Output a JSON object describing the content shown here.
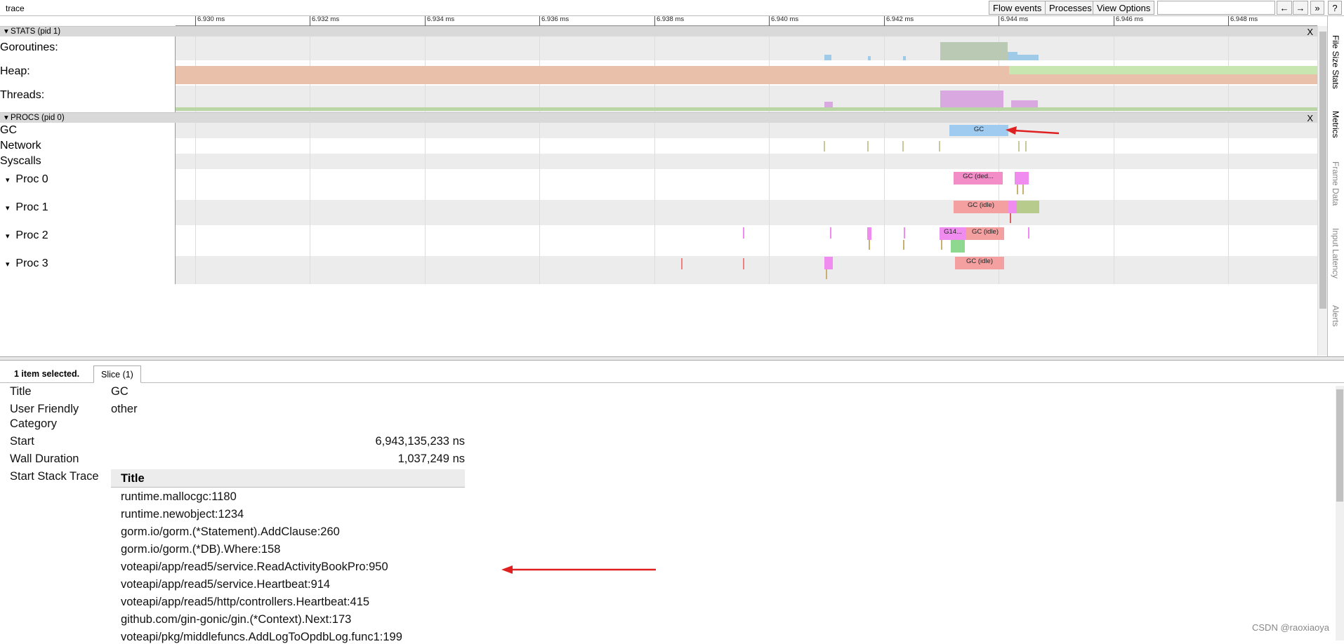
{
  "toolbar": {
    "title": "trace",
    "flow_events": "Flow events",
    "processes": "Processes",
    "view_options": "View Options",
    "search_value": "",
    "prev": "←",
    "next": "→",
    "more": "»",
    "help": "?"
  },
  "ruler": [
    "6.930 ms",
    "6.932 ms",
    "6.934 ms",
    "6.936 ms",
    "6.938 ms",
    "6.940 ms",
    "6.942 ms",
    "6.944 ms",
    "6.946 ms",
    "6.948 ms"
  ],
  "stats": {
    "header": "STATS (pid 1)",
    "close": "X",
    "goroutines": "Goroutines:",
    "heap": "Heap:",
    "threads": "Threads:"
  },
  "procs": {
    "header": "PROCS (pid 0)",
    "close": "X",
    "gc": "GC",
    "network": "Network",
    "syscalls": "Syscalls",
    "proc0": "Proc 0",
    "proc1": "Proc 1",
    "proc2": "Proc 2",
    "proc3": "Proc 3",
    "expand": "▾"
  },
  "slices": {
    "gc": "GC",
    "proc0_gc": "GC (ded...",
    "proc1_gc": "GC (idle)",
    "proc2_g": "G14...",
    "proc2_gc": "GC (idle)",
    "proc3_gc": "GC (idle)"
  },
  "side_tabs": [
    "File Size Stats",
    "Metrics",
    "Frame Data",
    "Input Latency",
    "Alerts"
  ],
  "colors": {
    "gc_slice": "#9fcbf0",
    "gc_ded": "#f28dc8",
    "gc_idle": "#f4a0a0",
    "goroutine_g": "#f08cf0",
    "heap_used": "#e9c0aa",
    "heap_next": "#c8e6b0",
    "annotation_arrow": "#e02020"
  },
  "details": {
    "selected": "1 item selected.",
    "tab": "Slice (1)",
    "title_label": "Title",
    "title_value": "GC",
    "category_label_1": "User Friendly",
    "category_label_2": "Category",
    "category_value": "other",
    "start_label": "Start",
    "start_value": "6,943,135,233 ns",
    "wall_label": "Wall Duration",
    "wall_value": "1,037,249 ns",
    "stack_label": "Start Stack Trace",
    "stack_header": "Title",
    "stack": [
      "runtime.mallocgc:1180",
      "runtime.newobject:1234",
      "gorm.io/gorm.(*Statement).AddClause:260",
      "gorm.io/gorm.(*DB).Where:158",
      "voteapi/app/read5/service.ReadActivityBookPro:950",
      "voteapi/app/read5/service.Heartbeat:914",
      "voteapi/app/read5/http/controllers.Heartbeat:415",
      "github.com/gin-gonic/gin.(*Context).Next:173",
      "voteapi/pkg/middlefuncs.AddLogToOpdbLog.func1:199"
    ]
  },
  "watermark": "CSDN @raoxiaoya"
}
